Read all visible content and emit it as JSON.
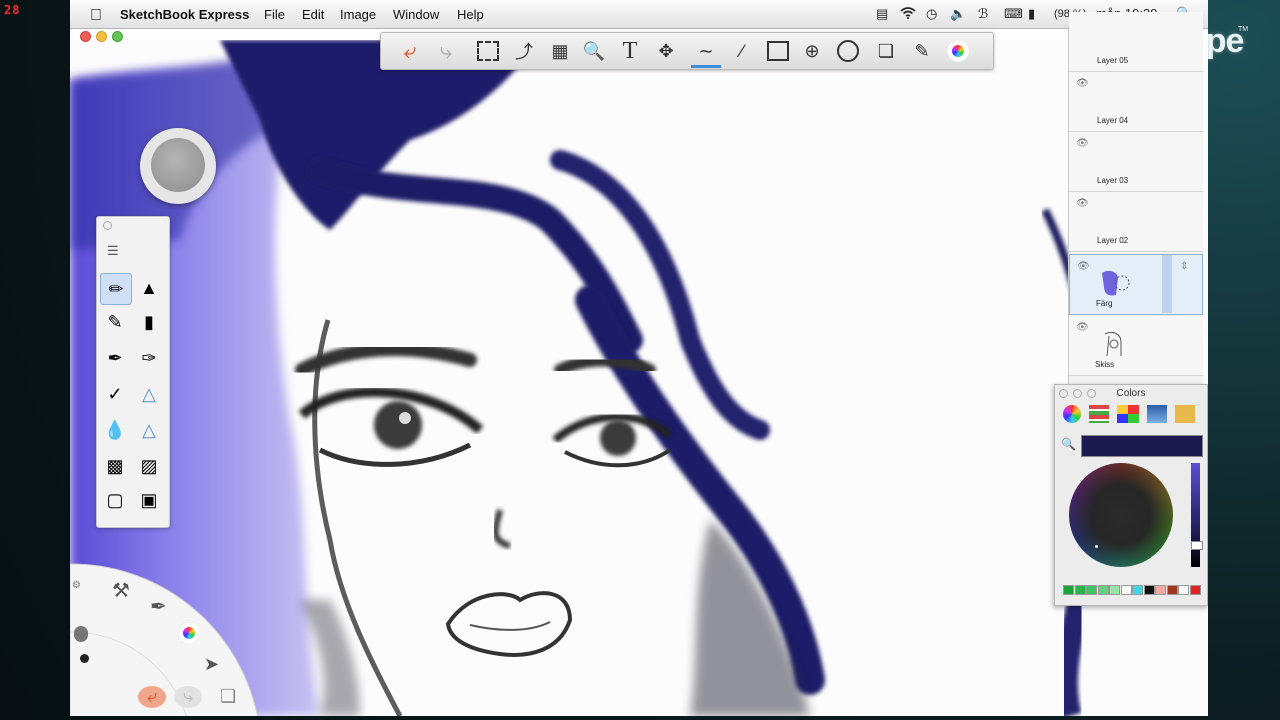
{
  "overlay": {
    "recording_timer": "28",
    "skype_brand": "skype",
    "skype_tm": "TM"
  },
  "menubar": {
    "app_name": "SketchBook Express",
    "menus": [
      "File",
      "Edit",
      "Image",
      "Window",
      "Help"
    ],
    "battery_text": "(98 %)",
    "clock": "mån 19:39"
  },
  "toolbar": {
    "tools": [
      "undo-icon",
      "redo-icon",
      "rect-select-icon",
      "lasso-icon",
      "crop-icon",
      "zoom-icon",
      "text-icon",
      "move-icon",
      "pencil-stroke-icon",
      "line-icon",
      "rectangle-icon",
      "polyline-icon",
      "ellipse-icon",
      "copy-layers-icon",
      "brushes-icon",
      "color-wheel-icon"
    ],
    "active_tool": "pencil-stroke-icon"
  },
  "layers": {
    "items": [
      {
        "name": "Layer 05",
        "visible": true
      },
      {
        "name": "Layer 04",
        "visible": true
      },
      {
        "name": "Layer 03",
        "visible": true
      },
      {
        "name": "Layer 02",
        "visible": true
      },
      {
        "name": "Färg",
        "visible": true,
        "selected": true
      },
      {
        "name": "Skiss",
        "visible": true
      }
    ]
  },
  "colors_panel": {
    "title": "Colors",
    "current_color": "#1c1a4e",
    "swatches": [
      "#17a33a",
      "#29b54a",
      "#3fc35e",
      "#62d179",
      "#9be2a8",
      "#ffffff",
      "#40d8e4",
      "#111111",
      "#f2aaa2",
      "#a0361f",
      "#ffffff",
      "#e12222"
    ]
  },
  "colors": {
    "ink_blue": "#1c1e6a",
    "hair_violet": "#7c6fe6",
    "accent_orange": "#e5511d"
  }
}
